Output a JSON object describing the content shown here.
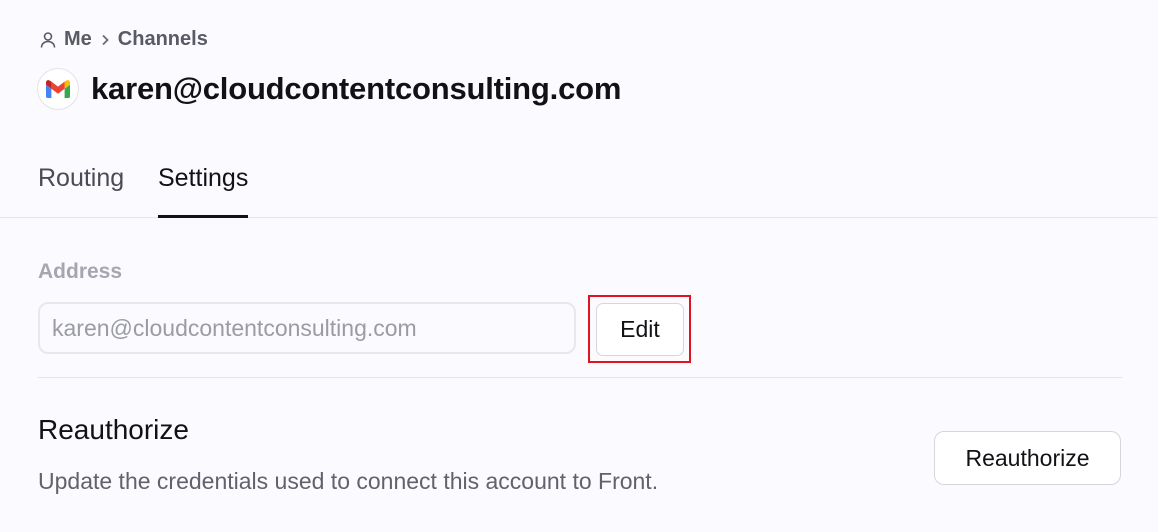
{
  "breadcrumb": {
    "icon": "person-icon",
    "items": [
      "Me",
      "Channels"
    ],
    "separator_icon": "chevron-right-icon"
  },
  "header": {
    "avatar_icon": "gmail-icon",
    "title": "karen@cloudcontentconsulting.com"
  },
  "tabs": [
    {
      "label": "Routing",
      "active": false
    },
    {
      "label": "Settings",
      "active": true
    }
  ],
  "address": {
    "label": "Address",
    "value": "karen@cloudcontentconsulting.com",
    "edit_label": "Edit"
  },
  "reauthorize": {
    "title": "Reauthorize",
    "description": "Update the credentials used to connect this account to Front.",
    "button_label": "Reauthorize"
  },
  "colors": {
    "highlight": "#e1141e",
    "background": "#fafaff"
  }
}
